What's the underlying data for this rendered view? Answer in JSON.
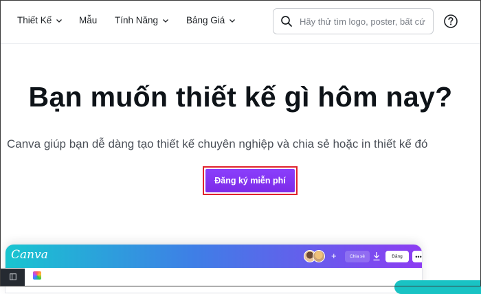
{
  "nav": {
    "items": [
      {
        "label": "Thiết Kế",
        "has_dropdown": true
      },
      {
        "label": "Mẫu",
        "has_dropdown": false
      },
      {
        "label": "Tính Năng",
        "has_dropdown": true
      },
      {
        "label": "Bảng Giá",
        "has_dropdown": true
      }
    ],
    "search": {
      "placeholder": "Hãy thử tìm logo, poster, bất cứ",
      "icon": "search-icon"
    },
    "help_icon": "help-circle-icon"
  },
  "hero": {
    "title": "Bạn muốn thiết kế gì hôm nay?",
    "subtitle": "Canva giúp bạn dễ dàng tạo thiết kế chuyên nghiệp và chia sẻ hoặc in thiết kế đó",
    "cta_label": "Đăng ký miễn phí"
  },
  "preview": {
    "logo": "Canva",
    "share_label": "Chia sẻ",
    "action_label": "Đăng",
    "more_label": "•••",
    "add_label": "+"
  },
  "colors": {
    "cta": "#7d2ae8",
    "cta_highlight_border": "#e0222c",
    "editor_gradient": [
      "#18c5d0",
      "#3e7fe6",
      "#8d3cf2"
    ]
  }
}
